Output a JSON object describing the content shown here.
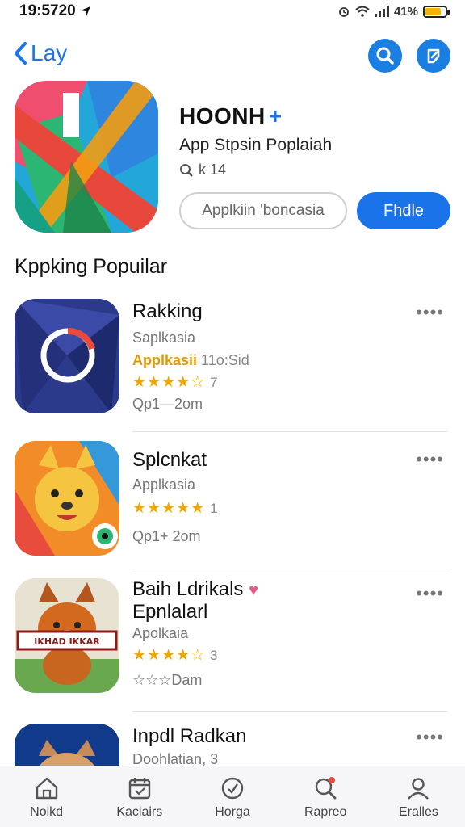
{
  "status": {
    "time": "19:5720",
    "battery": "41%",
    "battery_level": 0.8
  },
  "nav": {
    "back_label": "Lay"
  },
  "app": {
    "title": "HOONH",
    "title_badge": "+",
    "subtitle": "App Stpsin Poplaiah",
    "meta": "k 14",
    "secondary_button": "Applkiin 'boncasia",
    "primary_button": "Fhdle"
  },
  "section": {
    "title": "Kppking Popuilar"
  },
  "items": [
    {
      "name": "Rakking",
      "line1": "Saplkasia",
      "tag_highlight": "Applkasii",
      "tag_rest": "11o:Sid",
      "stars": "★★★★☆",
      "rating_count": "7",
      "line3": "Qp1—2om"
    },
    {
      "name": "Splcnkat",
      "line1": "Applkasia",
      "stars": "★★★★★",
      "rating_count": "1",
      "line3": "Qp1+ 2om"
    },
    {
      "name": "Baih Ldrikals",
      "name2": "Epnlalarl",
      "line1": "Apolkaia",
      "stars": "★★★★☆",
      "rating_count": "3",
      "line3": "☆☆☆Dam",
      "banner": "IKHAD IKKAR"
    },
    {
      "name": "Inpdl Radkan",
      "line1": "Doohlatian, 3"
    }
  ],
  "tabs": [
    {
      "label": "Noikd",
      "icon": "home-icon"
    },
    {
      "label": "Kaclairs",
      "icon": "calendar-icon"
    },
    {
      "label": "Horga",
      "icon": "compass-icon"
    },
    {
      "label": "Rapreo",
      "icon": "search-icon"
    },
    {
      "label": "Eralles",
      "icon": "person-icon"
    }
  ],
  "colors": {
    "accent": "#1a73e8",
    "star": "#f0a500",
    "highlight": "#e39a00"
  }
}
